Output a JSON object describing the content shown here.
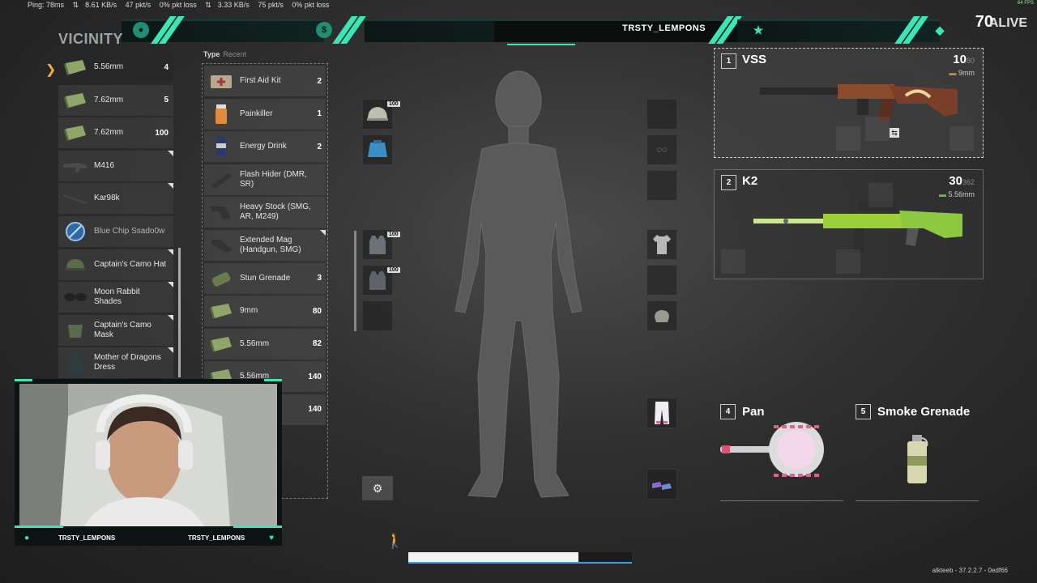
{
  "netbar": {
    "ping": "Ping: 78ms",
    "down_rate": "8.61 KB/s",
    "down_pkt": "47 pkt/s",
    "down_loss": "0% pkt loss",
    "up_rate": "3.33 KB/s",
    "up_pkt": "75 pkt/s",
    "up_loss": "0% pkt loss"
  },
  "fps": "64 FPS",
  "top": {
    "player_name": "TRSTY_LEMPONS",
    "alive_count": "70",
    "alive_label": "ALIVE"
  },
  "vicinity": {
    "title": "VICINITY",
    "items": [
      {
        "label": "5.56mm",
        "count": "4",
        "icon": "ammo-box-icon",
        "selected": true
      },
      {
        "label": "7.62mm",
        "count": "5",
        "icon": "ammo-box-icon"
      },
      {
        "label": "7.62mm",
        "count": "100",
        "icon": "ammo-box-icon"
      },
      {
        "label": "M416",
        "count": "",
        "icon": "rifle-icon",
        "corner": true
      },
      {
        "label": "Kar98k",
        "count": "",
        "icon": "sniper-rifle-icon",
        "corner": true
      },
      {
        "label": "Blue Chip Ssado0w",
        "count": "",
        "icon": "blue-chip-icon",
        "dim": true
      },
      {
        "label": "Captain's Camo Hat",
        "count": "",
        "icon": "hat-icon",
        "corner": true
      },
      {
        "label": "Moon Rabbit Shades",
        "count": "",
        "icon": "glasses-icon",
        "corner": true
      },
      {
        "label": "Captain's Camo Mask",
        "count": "",
        "icon": "mask-icon",
        "corner": true
      },
      {
        "label": "Mother of Dragons Dress",
        "count": "",
        "icon": "dress-icon",
        "corner": true
      }
    ]
  },
  "backpack": {
    "type_label": "Type",
    "recent_label": "Recent",
    "items": [
      {
        "label": "First Aid Kit",
        "count": "2",
        "icon": "first-aid-kit-icon"
      },
      {
        "label": "Painkiller",
        "count": "1",
        "icon": "painkiller-icon"
      },
      {
        "label": "Energy Drink",
        "count": "2",
        "icon": "energy-drink-icon"
      },
      {
        "label": "Flash Hider (DMR, SR)",
        "count": "",
        "icon": "flash-hider-icon"
      },
      {
        "label": "Heavy Stock (SMG, AR, M249)",
        "count": "",
        "icon": "stock-icon"
      },
      {
        "label": "Extended Mag (Handgun, SMG)",
        "count": "",
        "icon": "magazine-icon",
        "corner": true
      },
      {
        "label": "Stun Grenade",
        "count": "3",
        "icon": "grenade-icon"
      },
      {
        "label": "9mm",
        "count": "80",
        "icon": "ammo-box-icon"
      },
      {
        "label": "5.56mm",
        "count": "82",
        "icon": "ammo-box-icon"
      },
      {
        "label": "5.56mm",
        "count": "140",
        "icon": "ammo-box-icon"
      },
      {
        "label": "",
        "count": "140",
        "icon": "ammo-box-icon"
      }
    ]
  },
  "equipment": {
    "helmet_durability": "100",
    "vest_durability": "100",
    "backpack_durability": "100"
  },
  "weapons": [
    {
      "slot": "1",
      "name": "VSS",
      "ammo": "10",
      "ammo_total": "80",
      "caliber": "9mm",
      "active": true
    },
    {
      "slot": "2",
      "name": "K2",
      "ammo": "30",
      "ammo_total": "362",
      "caliber": "5.56mm"
    }
  ],
  "throwables": [
    {
      "slot": "4",
      "name": "Pan"
    },
    {
      "slot": "5",
      "name": "Smoke Grenade"
    }
  ],
  "cam": {
    "name_left": "TRSTY_LEMPONS",
    "name_right": "TRSTY_LEMPONS"
  },
  "loading_progress": 0.76,
  "version": "alkteeb - 37.2.2.7 - 0edf66",
  "colors": {
    "accent": "#37e8b4",
    "highlight_arrow": "#f0b030",
    "progress_line": "#3aa0e8"
  }
}
